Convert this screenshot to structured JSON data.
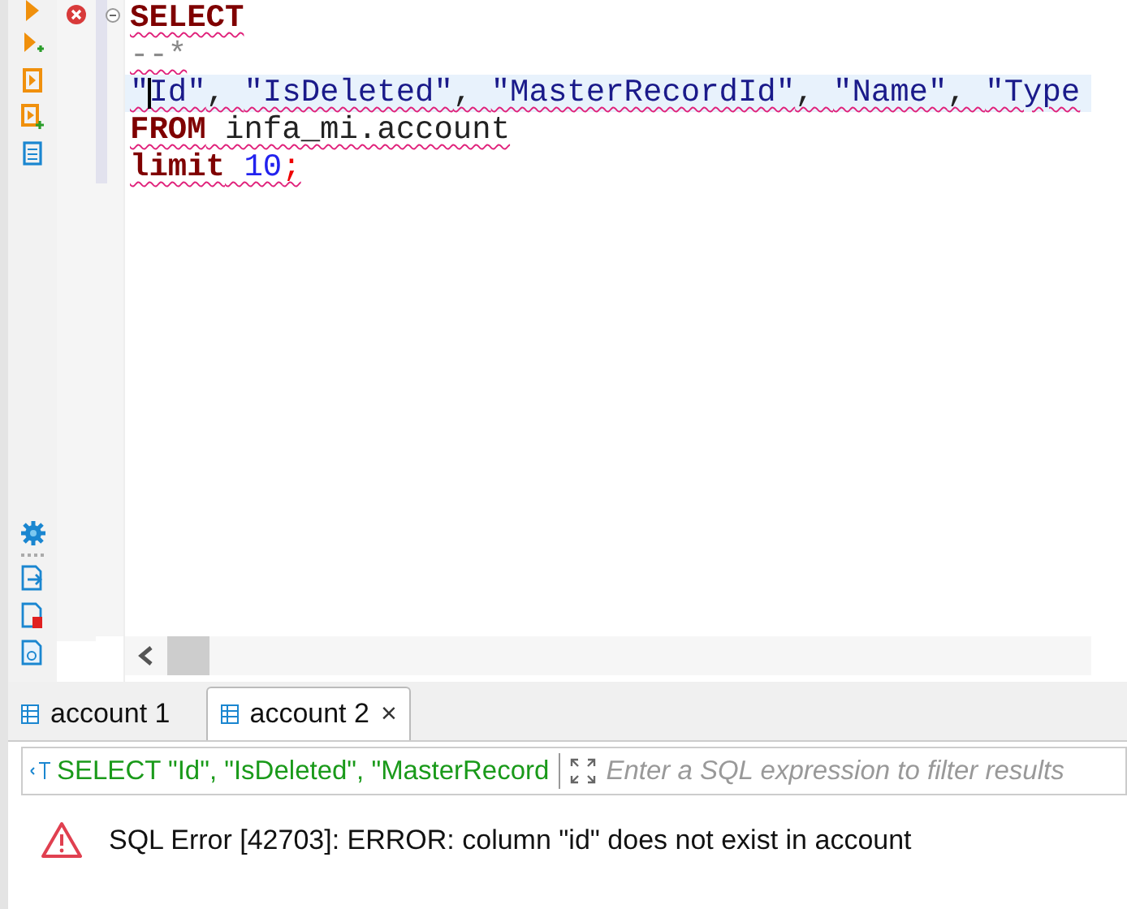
{
  "editor": {
    "error_line": true,
    "lines": [
      {
        "selected": false,
        "squiggle": true,
        "tokens": [
          {
            "kind": "keyword",
            "text": "SELECT"
          }
        ]
      },
      {
        "selected": false,
        "squiggle": true,
        "tokens": [
          {
            "kind": "comment",
            "text": "--*"
          }
        ]
      },
      {
        "selected": true,
        "squiggle": true,
        "tokens": [
          {
            "kind": "string",
            "text": "\"Id\""
          },
          {
            "kind": "plain",
            "text": ", "
          },
          {
            "kind": "string",
            "text": "\"IsDeleted\""
          },
          {
            "kind": "plain",
            "text": ", "
          },
          {
            "kind": "string",
            "text": "\"MasterRecordId\""
          },
          {
            "kind": "plain",
            "text": ", "
          },
          {
            "kind": "string",
            "text": "\"Name\""
          },
          {
            "kind": "plain",
            "text": ", "
          },
          {
            "kind": "string",
            "text": "\"Type"
          }
        ]
      },
      {
        "selected": false,
        "squiggle": true,
        "tokens": [
          {
            "kind": "keyword",
            "text": "FROM"
          },
          {
            "kind": "plain",
            "text": " infa_mi.account"
          }
        ]
      },
      {
        "selected": false,
        "squiggle": true,
        "tokens": [
          {
            "kind": "keyword",
            "text": "limit"
          },
          {
            "kind": "number",
            "text": " 10"
          },
          {
            "kind": "punct",
            "text": ";"
          }
        ]
      }
    ]
  },
  "result_tabs": [
    {
      "label": "account 1",
      "selected": false
    },
    {
      "label": "account 2",
      "selected": true,
      "close": "×"
    }
  ],
  "filter": {
    "query": "SELECT \"Id\", \"IsDeleted\", \"MasterRecord",
    "placeholder": "Enter a SQL expression to filter results"
  },
  "error": {
    "message": "SQL Error [42703]: ERROR: column \"id\" does not exist in account"
  }
}
